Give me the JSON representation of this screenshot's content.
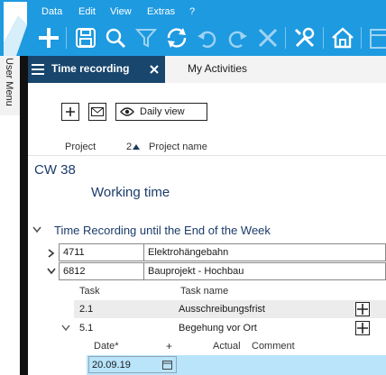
{
  "menu": [
    "Data",
    "Edit",
    "View",
    "Extras",
    "?"
  ],
  "sidebar": {
    "user_menu": "User Menu"
  },
  "tabs": {
    "active": "Time recording",
    "second": "My Activities"
  },
  "toolbar": {
    "view_button": "Daily view"
  },
  "columns": {
    "project": "Project",
    "sort_indicator": "2",
    "project_name": "Project name"
  },
  "week_label": "CW 38",
  "section_title": "Working time",
  "group_title": "Time Recording until the End of the Week",
  "projects": [
    {
      "number": "4711",
      "name": "Elektrohängebahn"
    },
    {
      "number": "6812",
      "name": "Bauprojekt - Hochbau"
    }
  ],
  "task_columns": {
    "task": "Task",
    "task_name": "Task name"
  },
  "tasks": [
    {
      "number": "2.1",
      "name": "Ausschreibungsfrist"
    },
    {
      "number": "5.1",
      "name": "Begehung vor Ort"
    }
  ],
  "entry_columns": {
    "date": "Date*",
    "add": "+",
    "actual": "Actual",
    "comment": "Comment"
  },
  "entry": {
    "date": "20.09.19"
  },
  "colors": {
    "brand": "#1e9ae0",
    "tab_active": "#19466d",
    "highlight": "#b9e4fa"
  }
}
